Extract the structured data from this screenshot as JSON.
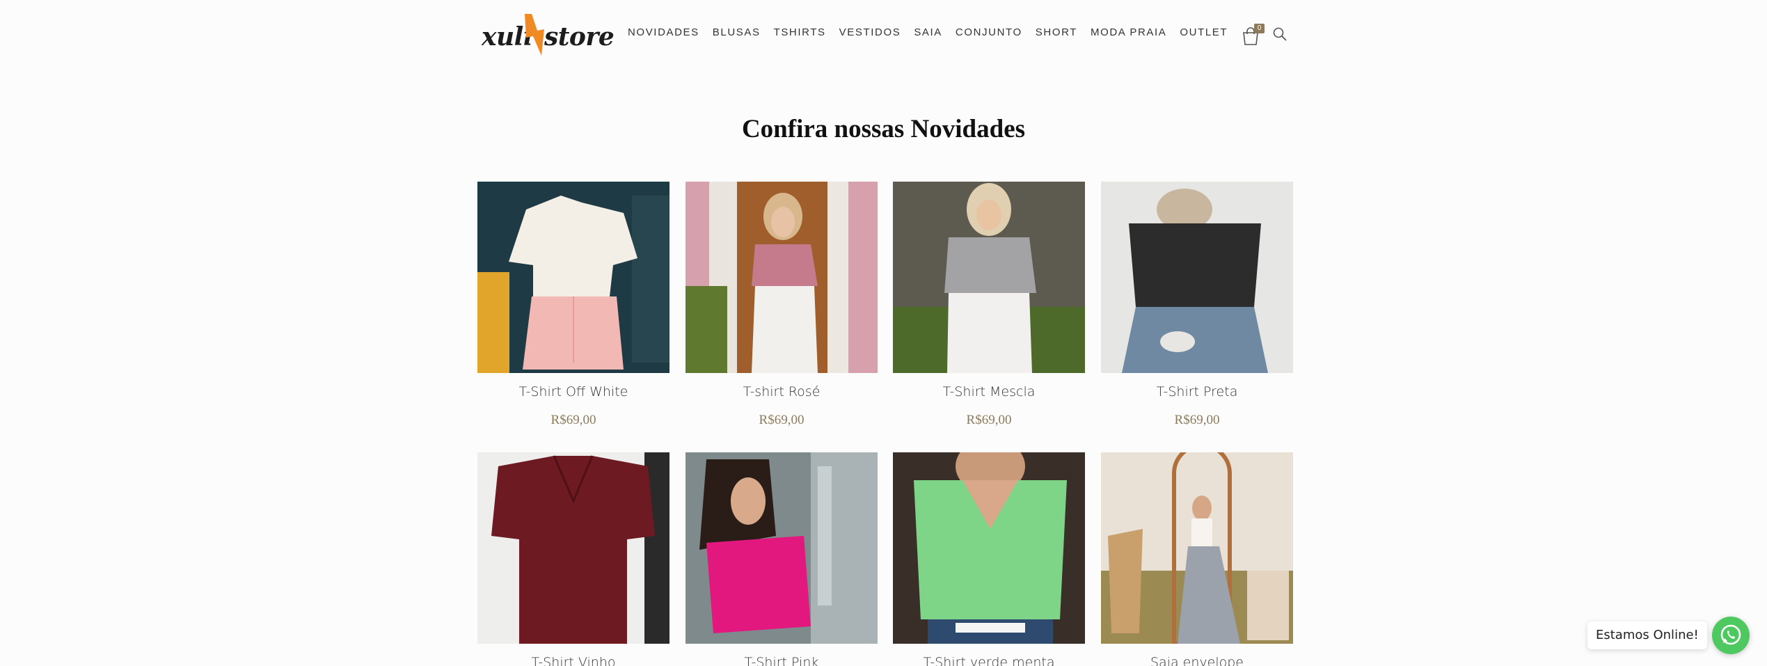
{
  "brand": {
    "logo_left": "xuli",
    "logo_right": "store",
    "accent": "#f08a24"
  },
  "nav": {
    "items": [
      "NOVIDADES",
      "BLUSAS",
      "TSHIRTS",
      "VESTIDOS",
      "SAIA",
      "CONJUNTO",
      "SHORT",
      "MODA PRAIA",
      "OUTLET"
    ]
  },
  "header": {
    "cart_icon": "shopping-bag-icon",
    "cart_count": "0",
    "search_icon": "search-icon"
  },
  "section": {
    "title": "Confira nossas Novidades"
  },
  "products": [
    {
      "name": "T-Shirt Off White",
      "price": "R$69,00"
    },
    {
      "name": "T-shirt Rosé",
      "price": "R$69,00"
    },
    {
      "name": "T-Shirt Mescla",
      "price": "R$69,00"
    },
    {
      "name": "T-Shirt Preta",
      "price": "R$69,00"
    },
    {
      "name": "T-Shirt Vinho",
      "price": ""
    },
    {
      "name": "T-Shirt Pink",
      "price": ""
    },
    {
      "name": "T-Shirt verde menta",
      "price": ""
    },
    {
      "name": "Saia envelope",
      "price": ""
    }
  ],
  "chat": {
    "label": "Estamos Online!",
    "icon": "whatsapp-icon",
    "color": "#4dc95f"
  },
  "colors": {
    "price": "#8c7a5b",
    "background": "#fcfcfc"
  }
}
